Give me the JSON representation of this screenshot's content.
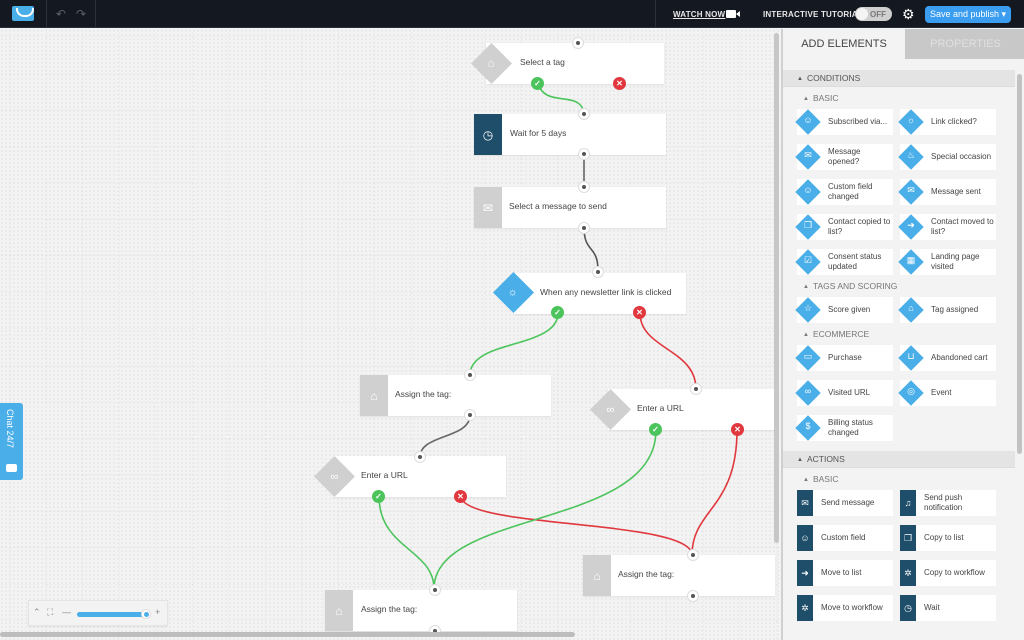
{
  "topbar": {
    "logo_icon": "envelope-smile-logo",
    "undo_icon": "undo-icon",
    "redo_icon": "redo-icon",
    "watch_now": "WATCH NOW",
    "interactive_tutorial": "INTERACTIVE TUTORIAL",
    "tutorial_toggle": "OFF",
    "publish_label": "Save and publish ▾"
  },
  "canvas": {
    "nodes": [
      {
        "label": "Select a tag",
        "kind": "condition",
        "icon": "tag-icon",
        "active": false
      },
      {
        "label": "Wait for 5 days",
        "kind": "action",
        "icon": "clock-icon",
        "active": true
      },
      {
        "label": "Select a message to send",
        "kind": "action",
        "icon": "envelope-icon",
        "active": false
      },
      {
        "label": "When any newsletter link is clicked",
        "kind": "condition",
        "icon": "link-click-icon",
        "active": true
      },
      {
        "label": "Assign the tag:",
        "kind": "action",
        "icon": "tag-icon",
        "active": false
      },
      {
        "label": "Enter a URL",
        "kind": "condition",
        "icon": "link-icon",
        "active": false
      },
      {
        "label": "Enter a URL",
        "kind": "condition",
        "icon": "link-icon",
        "active": false
      },
      {
        "label": "Assign the tag:",
        "kind": "action",
        "icon": "tag-icon",
        "active": false
      },
      {
        "label": "Assign the tag:",
        "kind": "action",
        "icon": "tag-icon",
        "active": false
      }
    ],
    "colors": {
      "yes": "#4cc45c",
      "no": "#e0383e",
      "neutral": "#666666",
      "accent": "#4aaee8",
      "action_dark": "#1f4e6b"
    }
  },
  "chat": {
    "label": "Chat 24/7"
  },
  "zoom_control": {
    "level_percent": 100
  },
  "panel": {
    "tabs": [
      "ADD ELEMENTS",
      "PROPERTIES"
    ],
    "conditions_title": "CONDITIONS",
    "basic_title": "BASIC",
    "conditions_basic": [
      {
        "label": "Subscribed via...",
        "icon": "user-icon"
      },
      {
        "label": "Link clicked?",
        "icon": "link-click-icon"
      },
      {
        "label": "Message opened?",
        "icon": "open-envelope-icon"
      },
      {
        "label": "Special occasion",
        "icon": "cake-icon"
      },
      {
        "label": "Custom field changed",
        "icon": "user-field-icon"
      },
      {
        "label": "Message sent",
        "icon": "sent-envelope-icon"
      },
      {
        "label": "Contact copied to list?",
        "icon": "copy-icon"
      },
      {
        "label": "Contact moved to list?",
        "icon": "arrow-circle-icon"
      },
      {
        "label": "Consent status updated",
        "icon": "checkbox-icon"
      },
      {
        "label": "Landing page visited",
        "icon": "layout-icon"
      }
    ],
    "tags_title": "TAGS AND SCORING",
    "tags": [
      {
        "label": "Score given",
        "icon": "star-icon"
      },
      {
        "label": "Tag assigned",
        "icon": "tag-icon"
      }
    ],
    "ecommerce_title": "ECOMMERCE",
    "ecommerce": [
      {
        "label": "Purchase",
        "icon": "wallet-icon"
      },
      {
        "label": "Abandoned cart",
        "icon": "basket-icon"
      },
      {
        "label": "Visited URL",
        "icon": "link-icon"
      },
      {
        "label": "Event",
        "icon": "target-icon"
      },
      {
        "label": "Billing status changed",
        "icon": "dollar-cycle-icon"
      }
    ],
    "actions_title": "ACTIONS",
    "actions_basic_title": "BASIC",
    "actions": [
      {
        "label": "Send message",
        "icon": "envelope-icon"
      },
      {
        "label": "Send push notification",
        "icon": "bell-icon"
      },
      {
        "label": "Custom field",
        "icon": "user-field-icon"
      },
      {
        "label": "Copy to list",
        "icon": "copy-icon"
      },
      {
        "label": "Move to list",
        "icon": "arrow-circle-icon"
      },
      {
        "label": "Copy to workflow",
        "icon": "gear-copy-icon"
      },
      {
        "label": "Move to workflow",
        "icon": "gear-arrow-icon"
      },
      {
        "label": "Wait",
        "icon": "clock-icon"
      }
    ]
  }
}
